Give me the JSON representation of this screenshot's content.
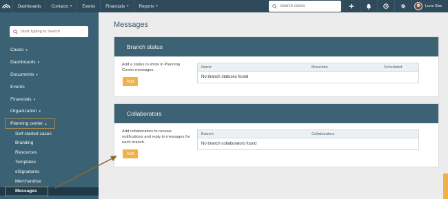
{
  "topbar": {
    "nav": [
      {
        "label": "Dashboards",
        "caret": false
      },
      {
        "label": "Contacts",
        "caret": true
      },
      {
        "label": "Events",
        "caret": false
      },
      {
        "label": "Financials",
        "caret": true
      },
      {
        "label": "Reports",
        "caret": true
      }
    ],
    "search_placeholder": "Search cases",
    "user_name": "Lone Star"
  },
  "sidebar": {
    "search_placeholder": "Start Typing to Search",
    "items": [
      {
        "label": "Cases",
        "caret": true
      },
      {
        "label": "Dashboards",
        "caret": true
      },
      {
        "label": "Documents",
        "caret": true
      },
      {
        "label": "Events",
        "caret": false
      },
      {
        "label": "Financials",
        "caret": true
      },
      {
        "label": "Organization",
        "caret": true
      },
      {
        "label": "Planning center",
        "caret": true
      }
    ],
    "sub_items": [
      "Self-started cases",
      "Branding",
      "Resources",
      "Templates",
      "eSignatures",
      "Merchandise",
      "Messages"
    ]
  },
  "main": {
    "title": "Messages",
    "branch_panel": {
      "heading": "Branch status",
      "description": "Add a status to show in Planning Center messages.",
      "button": "Add",
      "columns": [
        "Name",
        "Branches",
        "Scheduled"
      ],
      "empty_text": "No branch statuses found"
    },
    "collab_panel": {
      "heading": "Collaborators",
      "description": "Add collaborators to receive notifications and reply to messages for each branch.",
      "button": "Add",
      "columns": [
        "Branch",
        "Collaborators"
      ],
      "empty_text": "No branch collaborators found"
    }
  },
  "colors": {
    "topbar": "#2f4a5a",
    "sidebar": "#3a6274",
    "panel_header": "#3d6273",
    "accent_button": "#f0b04a",
    "highlight_box": "#a98a4a",
    "arrow": "#8a6a2a"
  }
}
